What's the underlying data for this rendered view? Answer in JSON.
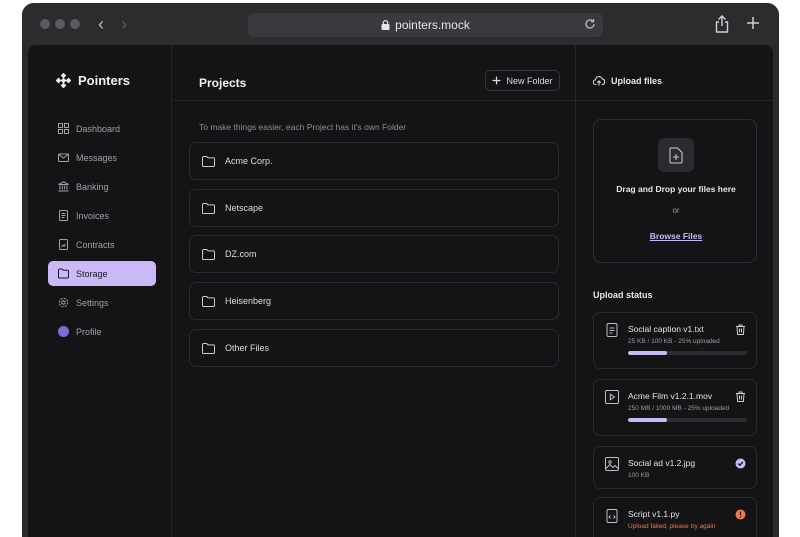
{
  "browser": {
    "url": "pointers.mock"
  },
  "brand": {
    "name": "Pointers"
  },
  "sidebar": {
    "items": [
      {
        "label": "Dashboard",
        "icon": "dashboard-icon",
        "active": false
      },
      {
        "label": "Messages",
        "icon": "mail-icon",
        "active": false
      },
      {
        "label": "Banking",
        "icon": "bank-icon",
        "active": false
      },
      {
        "label": "Invoices",
        "icon": "invoice-icon",
        "active": false
      },
      {
        "label": "Contracts",
        "icon": "contract-icon",
        "active": false
      },
      {
        "label": "Storage",
        "icon": "folder-icon",
        "active": true
      },
      {
        "label": "Settings",
        "icon": "gear-icon",
        "active": false
      },
      {
        "label": "Profile",
        "icon": "avatar",
        "active": false
      }
    ]
  },
  "main": {
    "title": "Projects",
    "new_folder_label": "New Folder",
    "hint": "To make things easier, each Project has it's own Folder",
    "folders": [
      "Acme Corp.",
      "Netscape",
      "DZ.com",
      "Heisenberg",
      "Other Files"
    ]
  },
  "upload": {
    "title": "Upload files",
    "dropzone_title": "Drag and Drop your files here",
    "or": "or",
    "browse": "Browse Files",
    "status_title": "Upload status",
    "files": [
      {
        "name": "Social caption v1.txt",
        "meta": "25 KB / 100 KB - 25% uploaded",
        "progress": 0.33,
        "state": "uploading",
        "icon": "text-file-icon"
      },
      {
        "name": "Acme Film v1.2.1.mov",
        "meta": "250 MB / 1000 MB - 25% uploaded",
        "progress": 0.33,
        "state": "uploading",
        "icon": "video-file-icon"
      },
      {
        "name": "Social ad v1.2.jpg",
        "meta": "100 KB",
        "state": "done",
        "icon": "image-file-icon"
      },
      {
        "name": "Script v1.1.py",
        "meta": "Upload failed, please try again",
        "state": "error",
        "icon": "code-file-icon"
      }
    ]
  },
  "colors": {
    "accent": "#cbb8f6",
    "background": "#141416",
    "error": "#ee7a4b"
  }
}
